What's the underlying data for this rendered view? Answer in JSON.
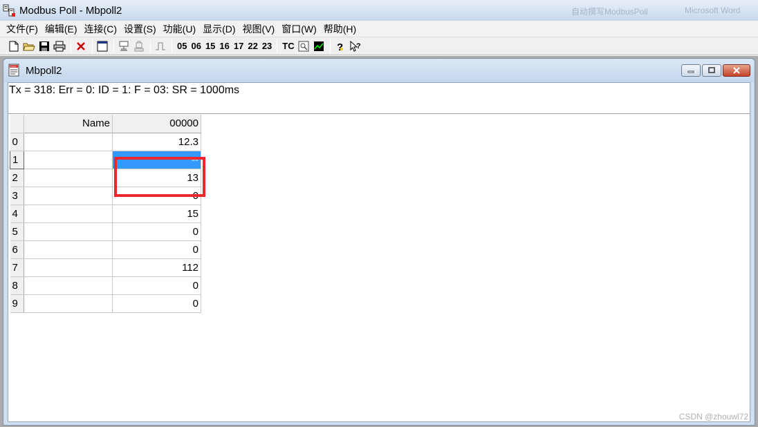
{
  "app": {
    "title": "Modbus Poll - Mbpoll2",
    "background_tasks": [
      "自动撰写ModbusPoll",
      "Microsoft Word"
    ]
  },
  "menu": [
    "文件(F)",
    "编辑(E)",
    "连接(C)",
    "设置(S)",
    "功能(U)",
    "显示(D)",
    "视图(V)",
    "窗口(W)",
    "帮助(H)"
  ],
  "toolbar": {
    "icons": [
      "new-file-icon",
      "open-folder-icon",
      "save-icon",
      "print-icon",
      "delete-icon",
      "window-icon",
      "connect-icon",
      "disconnect-icon",
      "pulse-icon"
    ],
    "function_codes": [
      "05",
      "06",
      "15",
      "16",
      "17",
      "22",
      "23"
    ],
    "tc_label": "TC",
    "tail_icons": [
      "monitor-icon",
      "chart-icon",
      "help-icon",
      "context-help-icon"
    ]
  },
  "child_window": {
    "title": "Mbpoll2",
    "status": "Tx = 318: Err = 0: ID = 1: F = 03: SR = 1000ms"
  },
  "grid": {
    "name_header": "Name",
    "value_header": "00000",
    "rows": [
      {
        "index": "0",
        "name": "",
        "value": "12.3"
      },
      {
        "index": "1",
        "name": "",
        "value": "--"
      },
      {
        "index": "2",
        "name": "",
        "value": "13"
      },
      {
        "index": "3",
        "name": "",
        "value": "0"
      },
      {
        "index": "4",
        "name": "",
        "value": "15"
      },
      {
        "index": "5",
        "name": "",
        "value": "0"
      },
      {
        "index": "6",
        "name": "",
        "value": "0"
      },
      {
        "index": "7",
        "name": "",
        "value": "112"
      },
      {
        "index": "8",
        "name": "",
        "value": "0"
      },
      {
        "index": "9",
        "name": "",
        "value": "0"
      }
    ],
    "selected_row": "1"
  },
  "colors": {
    "selection": "#3399ff",
    "highlight_box": "#f0272a"
  },
  "watermark": "CSDN @zhouwl72"
}
